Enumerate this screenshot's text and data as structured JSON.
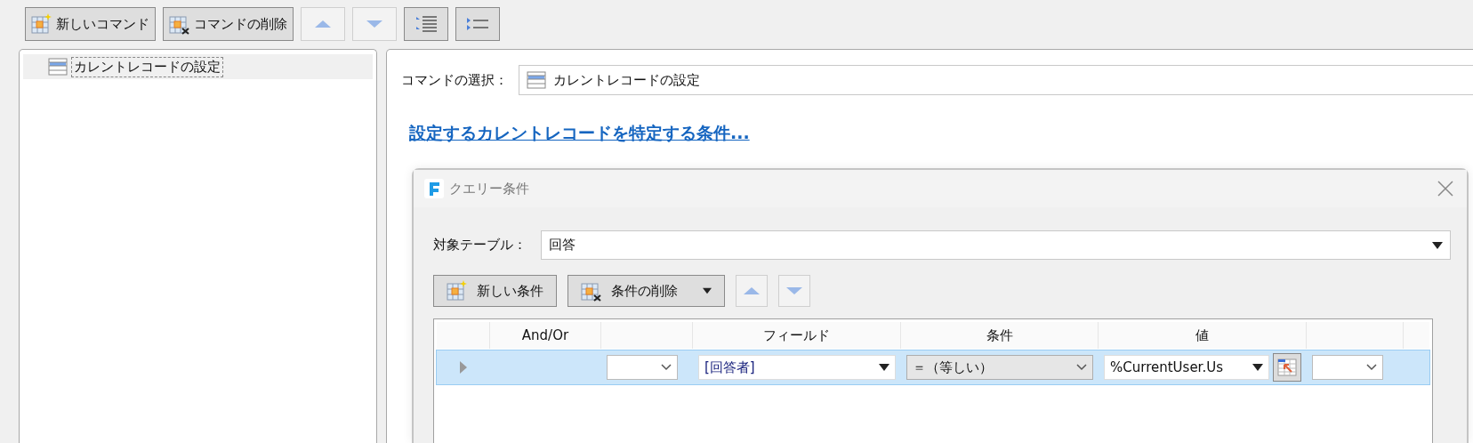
{
  "toolbar": [
    {
      "kind": "new",
      "label": "新しいコマンド",
      "disabled": false
    },
    {
      "kind": "delete",
      "label": "コマンドの削除",
      "disabled": false
    },
    {
      "kind": "up",
      "disabled": true
    },
    {
      "kind": "down",
      "disabled": true
    },
    {
      "kind": "indent",
      "disabled": false
    },
    {
      "kind": "outdent",
      "disabled": false
    }
  ],
  "tree": {
    "items": [
      {
        "label": "カレントレコードの設定",
        "selected": true
      }
    ]
  },
  "command_select": {
    "label": "コマンドの選択：",
    "value": "カレントレコードの設定"
  },
  "link": "設定するカレントレコードを特定する条件...",
  "dialog": {
    "title": "クエリー条件",
    "target_table": {
      "label": "対象テーブル：",
      "value": "回答"
    },
    "buttons": [
      {
        "kind": "new",
        "label": "新しい条件",
        "disabled": false
      },
      {
        "kind": "delete",
        "label": "条件の削除",
        "disabled": false,
        "dropdown": true
      },
      {
        "kind": "up",
        "disabled": true
      },
      {
        "kind": "down",
        "disabled": true
      }
    ],
    "columns": [
      {
        "kind": "rowheader"
      },
      {
        "kind": "text",
        "header": "And/Or"
      },
      {
        "kind": "text"
      },
      {
        "kind": "text",
        "header": "フィールド"
      },
      {
        "kind": "text",
        "header": "条件"
      },
      {
        "kind": "text",
        "header": "値"
      },
      {
        "kind": "text"
      },
      {
        "kind": "filler"
      }
    ],
    "rows": [
      {
        "selected": true,
        "cells": [
          {
            "kind": "indicator"
          },
          {
            "kind": "empty"
          },
          {
            "kind": "combo"
          },
          {
            "kind": "dropdown",
            "value": "[回答者]"
          },
          {
            "kind": "select",
            "value": "＝（等しい）"
          },
          {
            "kind": "value",
            "value": "%CurrentUser.Us"
          },
          {
            "kind": "combo"
          },
          {
            "kind": "empty"
          }
        ]
      }
    ]
  }
}
